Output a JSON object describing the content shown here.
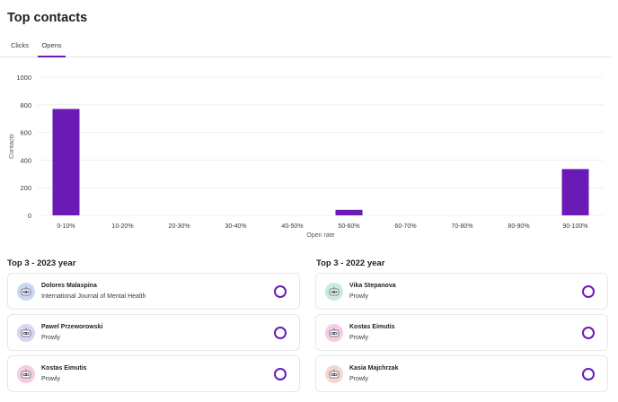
{
  "page": {
    "title": "Top contacts"
  },
  "tabs": [
    {
      "label": "Clicks",
      "active": false
    },
    {
      "label": "Opens",
      "active": true
    }
  ],
  "colors": {
    "accent": "#6a1bb5"
  },
  "chart_data": {
    "type": "bar",
    "categories": [
      "0-10%",
      "10-20%",
      "20-30%",
      "30-40%",
      "40-50%",
      "50-60%",
      "60-70%",
      "70-80%",
      "80-90%",
      "90-100%"
    ],
    "values": [
      770,
      0,
      0,
      0,
      0,
      40,
      0,
      0,
      0,
      335
    ],
    "xlabel": "Open rate",
    "ylabel": "Contacts",
    "ylim": [
      0,
      1000
    ],
    "yticks": [
      0,
      200,
      400,
      600,
      800,
      1000
    ],
    "grid": true
  },
  "sections": [
    {
      "title": "Top 3 - 2023 year",
      "contacts": [
        {
          "name": "Dolores Malaspina",
          "sub": "International Journal of Mental Health",
          "avatar": "robot-avatar-blue-icon"
        },
        {
          "name": "Pawel Przeworowski",
          "sub": "Prowly",
          "avatar": "robot-avatar-purple-icon"
        },
        {
          "name": "Kostas Eimutis",
          "sub": "Prowly",
          "avatar": "robot-avatar-pink-icon"
        }
      ]
    },
    {
      "title": "Top 3 - 2022 year",
      "contacts": [
        {
          "name": "Vika Stepanova",
          "sub": "Prowly",
          "avatar": "robot-avatar-green-icon"
        },
        {
          "name": "Kostas Eimutis",
          "sub": "Prowly",
          "avatar": "robot-avatar-pink-icon"
        },
        {
          "name": "Kasia Majchrzak",
          "sub": "Prowly",
          "avatar": "robot-avatar-peach-icon"
        }
      ]
    }
  ]
}
